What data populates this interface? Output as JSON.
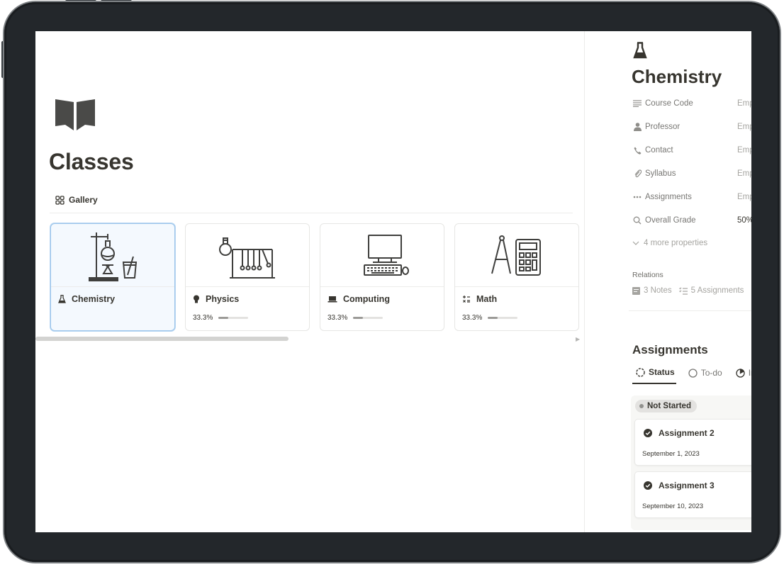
{
  "page": {
    "icon": "open-book-icon",
    "title": "Classes",
    "view_tab": {
      "icon": "gallery-grid-icon",
      "label": "Gallery"
    }
  },
  "cards": [
    {
      "name": "Chemistry",
      "icon": "flask-icon",
      "cover": "chemistry-lab-illustration",
      "selected": true
    },
    {
      "name": "Physics",
      "icon": "lightbulb-icon",
      "cover": "newtons-cradle-illustration",
      "progress_label": "33.3%",
      "progress": 0.333
    },
    {
      "name": "Computing",
      "icon": "laptop-icon",
      "cover": "desktop-computer-illustration",
      "progress_label": "33.3%",
      "progress": 0.333
    },
    {
      "name": "Math",
      "icon": "math-operators-icon",
      "cover": "compass-calculator-illustration",
      "progress_label": "33.3%",
      "progress": 0.333
    }
  ],
  "side_panel": {
    "icon": "flask-icon",
    "title": "Chemistry",
    "properties": [
      {
        "icon": "text-lines-icon",
        "label": "Course Code",
        "value": "Emp"
      },
      {
        "icon": "person-icon",
        "label": "Professor",
        "value": "Emp"
      },
      {
        "icon": "phone-icon",
        "label": "Contact",
        "value": "Emp"
      },
      {
        "icon": "paperclip-icon",
        "label": "Syllabus",
        "value": "Emp"
      },
      {
        "icon": "dots-icon",
        "label": "Assignments",
        "value": "Emp"
      },
      {
        "icon": "search-icon",
        "label": "Overall Grade",
        "value": "50%"
      }
    ],
    "more_properties": "4 more properties",
    "relations_heading": "Relations",
    "relations": [
      {
        "icon": "notes-icon",
        "label": "3 Notes"
      },
      {
        "icon": "checklist-icon",
        "label": "5 Assignments"
      }
    ],
    "assignments": {
      "title": "Assignments",
      "tabs": [
        {
          "icon": "status-dashed-circle-icon",
          "label": "Status",
          "active": true
        },
        {
          "icon": "empty-circle-icon",
          "label": "To-do"
        },
        {
          "icon": "in-progress-circle-icon",
          "label": "In"
        }
      ],
      "group": "Not Started",
      "items": [
        {
          "title": "Assignment 2",
          "date": "September 1, 2023"
        },
        {
          "title": "Assignment 3",
          "date": "September 10, 2023"
        }
      ]
    }
  },
  "colors": {
    "text": "#37352f",
    "muted": "#787774",
    "selection": "#9cc5ea",
    "bezel": "#23272b"
  }
}
